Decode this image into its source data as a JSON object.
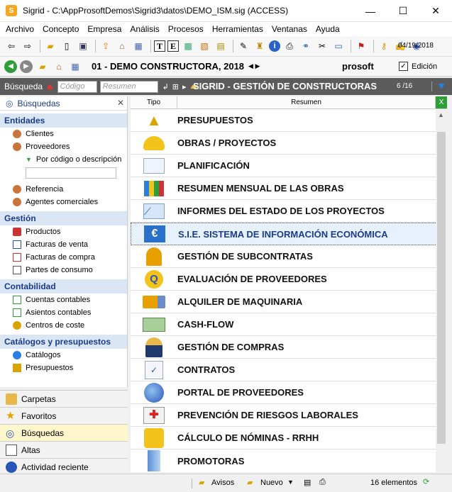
{
  "window": {
    "title": "Sigrid - C:\\AppProsoftDemos\\Sigrid3\\datos\\DEMO_ISM.sig (ACCESS)"
  },
  "menu": [
    "Archivo",
    "Concepto",
    "Empresa",
    "Análisis",
    "Procesos",
    "Herramientas",
    "Ventanas",
    "Ayuda"
  ],
  "toolbar": {
    "date": "04/19/2018"
  },
  "company": {
    "name": "01 - DEMO CONSTRUCTORA, 2018",
    "brand": "prosoft",
    "edicion": "Edición"
  },
  "search": {
    "label": "Búsqueda",
    "codigo_ph": "Código",
    "resumen_ph": "Resumen",
    "section_title": "SIGRID - GESTIÓN DE CONSTRUCTORAS",
    "pager": "6 /16"
  },
  "sidebar": {
    "header": "Búsquedas",
    "groups": [
      {
        "title": "Entidades",
        "items": [
          "Clientes",
          "Proveedores",
          "Por código o descripción",
          "Referencia",
          "Agentes comerciales"
        ]
      },
      {
        "title": "Gestión",
        "items": [
          "Productos",
          "Facturas de venta",
          "Facturas de compra",
          "Partes de consumo"
        ]
      },
      {
        "title": "Contabilidad",
        "items": [
          "Cuentas contables",
          "Asientos contables",
          "Centros de coste"
        ]
      },
      {
        "title": "Catálogos y presupuestos",
        "items": [
          "Catálogos",
          "Presupuestos"
        ]
      }
    ],
    "bottom": [
      "Carpetas",
      "Favoritos",
      "Búsquedas",
      "Altas",
      "Actividad reciente"
    ]
  },
  "table": {
    "col_tipo": "Tipo",
    "col_resumen": "Resumen",
    "rows": [
      "PRESUPUESTOS",
      "OBRAS / PROYECTOS",
      "PLANIFICACIÓN",
      "RESUMEN MENSUAL DE LAS OBRAS",
      "INFORMES DEL ESTADO DE LOS PROYECTOS",
      "S.I.E. SISTEMA DE INFORMACIÓN ECONÓMICA",
      "GESTIÓN DE SUBCONTRATAS",
      "EVALUACIÓN DE PROVEEDORES",
      "ALQUILER DE MAQUINARIA",
      "CASH-FLOW",
      "GESTIÓN DE COMPRAS",
      "CONTRATOS",
      "PORTAL DE PROVEEDORES",
      "PREVENCIÓN DE RIESGOS LABORALES",
      "CÁLCULO DE NÓMINAS - RRHH",
      "PROMOTORAS"
    ]
  },
  "status": {
    "avisos": "Avisos",
    "nuevo": "Nuevo",
    "count": "16 elementos"
  }
}
